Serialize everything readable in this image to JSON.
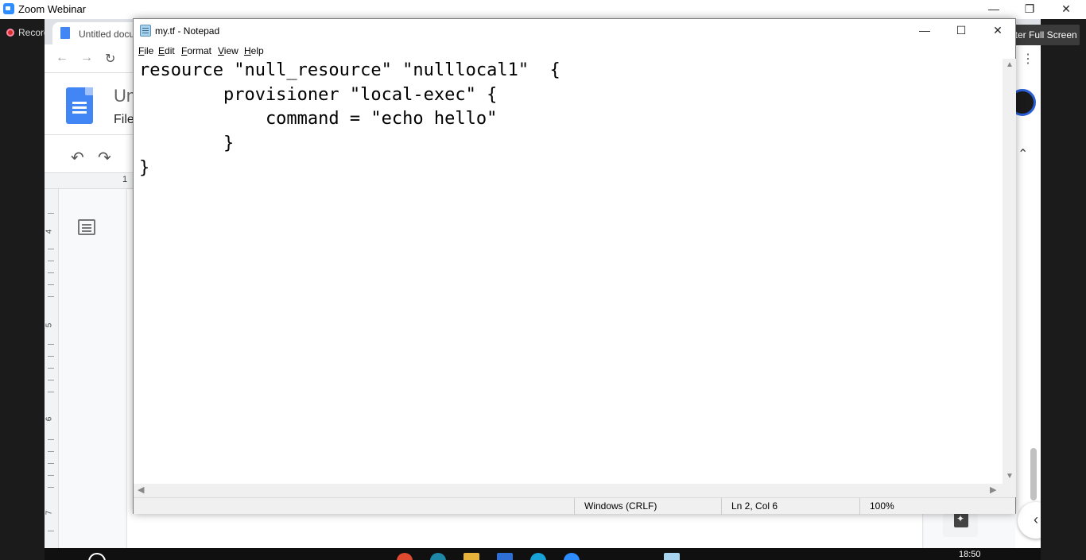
{
  "zoom": {
    "title": "Zoom Webinar",
    "recording_label": "Record",
    "fullscreen_label": "Enter Full Screen",
    "minimize": "—",
    "restore": "❐",
    "close": "✕"
  },
  "chrome": {
    "tab_title": "Untitled docu",
    "back": "←",
    "forward": "→",
    "reload": "↻",
    "kebab": "⋮"
  },
  "docs": {
    "doc_name": "Un",
    "menu_file": "File",
    "undo": "↶",
    "redo": "↷",
    "ruler_top": "1",
    "ruler_left": [
      "4",
      "5",
      "6",
      "7"
    ],
    "collapse": "⌃",
    "side_toggle": "‹"
  },
  "notepad": {
    "title": "my.tf - Notepad",
    "minimize": "—",
    "maximize": "☐",
    "close": "✕",
    "menu": [
      "File",
      "Edit",
      "Format",
      "View",
      "Help"
    ],
    "lines": [
      "resource \"null_resource\" \"nulllocal1\"  {",
      "        provisioner \"local-exec\" {",
      "            command = \"echo hello\"",
      "        }",
      "}"
    ],
    "status": {
      "line_ending": "Windows (CRLF)",
      "position": "Ln 2, Col 6",
      "zoom": "100%"
    }
  },
  "taskbar": {
    "time": "18:50"
  },
  "colors": {
    "zoom_dark": "#1b1b1b",
    "docs_blue": "#4285f4",
    "zoom_blue": "#2d8cff",
    "notepad_bg": "#ffffff",
    "status_bg": "#f0f0f0"
  },
  "icons": {
    "notepad_app": "notepad-icon",
    "docs_logo": "google-docs-icon",
    "explore": "explore-icon",
    "outline": "document-outline-icon"
  }
}
